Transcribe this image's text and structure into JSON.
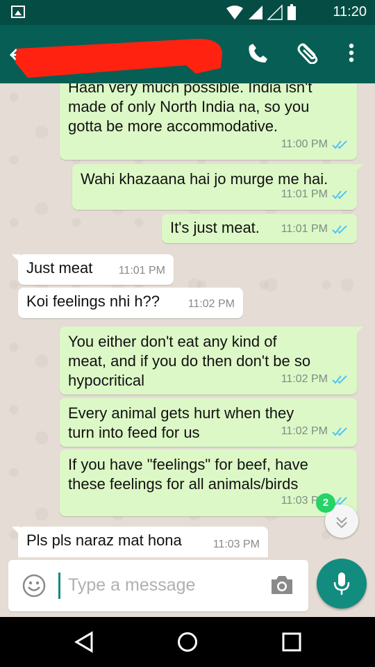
{
  "status_bar": {
    "time": "11:20"
  },
  "header": {
    "contact_name": ""
  },
  "messages": [
    {
      "direction": "out",
      "text": "Haan very much possible. India isn't\nmade of only North India na, so you\ngotta be more accommodative.",
      "time": "11:00 PM",
      "status": "read"
    },
    {
      "direction": "out",
      "text": "Wahi khazaana hai jo murge me hai.",
      "time": "11:01 PM",
      "status": "read"
    },
    {
      "direction": "out",
      "text": "It's just meat.",
      "time": "11:01 PM",
      "status": "read"
    },
    {
      "direction": "in",
      "text": "Just meat",
      "time": "11:01 PM"
    },
    {
      "direction": "in",
      "text": "Koi feelings nhi h??",
      "time": "11:02 PM"
    },
    {
      "direction": "out",
      "text": "You either don't eat any kind of\nmeat, and if you do then don't be so\nhypocritical",
      "time": "11:02 PM",
      "status": "read"
    },
    {
      "direction": "out",
      "text": "Every animal gets hurt when they\nturn into feed for us",
      "time": "11:02 PM",
      "status": "read"
    },
    {
      "direction": "out",
      "text": "If you have \"feelings\" for beef, have\nthese feelings for all animals/birds",
      "time": "11:03 PM",
      "status": "read"
    },
    {
      "direction": "in",
      "text": "Pls pls naraz mat hona",
      "time": "11:03 PM"
    }
  ],
  "unread_count": "2",
  "composer": {
    "placeholder": "Type a message"
  },
  "colors": {
    "app_bar": "#075e54",
    "status_bar": "#054d44",
    "outgoing_bubble": "#dcf8c6",
    "incoming_bubble": "#ffffff",
    "read_tick": "#4fc3f7",
    "fab": "#128c7e",
    "unread_badge": "#25d366"
  },
  "icons": {
    "status_left": "gallery-icon",
    "status_right": [
      "wifi-icon",
      "signal-icon",
      "signal-empty-icon",
      "battery-icon"
    ],
    "app_bar": [
      "back-arrow-icon",
      "phone-icon",
      "paperclip-icon",
      "overflow-menu-icon"
    ],
    "composer": [
      "emoji-icon",
      "camera-icon",
      "mic-icon"
    ],
    "nav": [
      "nav-back-icon",
      "nav-home-icon",
      "nav-recents-icon"
    ]
  }
}
